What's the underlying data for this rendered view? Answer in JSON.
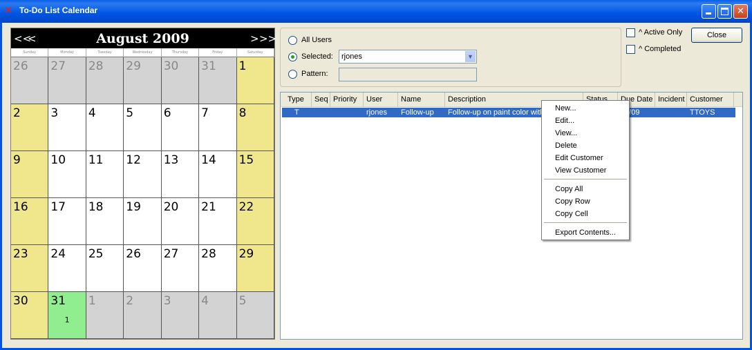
{
  "window": {
    "title": "To-Do List Calendar"
  },
  "calendar": {
    "month_label": "August 2009",
    "nav": {
      "prev_year": "<<",
      "prev_month": "<",
      "next_month": ">",
      "next_year": ">>"
    },
    "days_of_week": [
      "Sunday",
      "Monday",
      "Tuesday",
      "Wednesday",
      "Thursday",
      "Friday",
      "Saturday"
    ],
    "weeks": [
      [
        {
          "d": "26",
          "t": "other"
        },
        {
          "d": "27",
          "t": "other"
        },
        {
          "d": "28",
          "t": "other"
        },
        {
          "d": "29",
          "t": "other"
        },
        {
          "d": "30",
          "t": "other"
        },
        {
          "d": "31",
          "t": "other"
        },
        {
          "d": "1",
          "t": "weekend"
        }
      ],
      [
        {
          "d": "2",
          "t": "weekend"
        },
        {
          "d": "3",
          "t": "day"
        },
        {
          "d": "4",
          "t": "day"
        },
        {
          "d": "5",
          "t": "day"
        },
        {
          "d": "6",
          "t": "day"
        },
        {
          "d": "7",
          "t": "day"
        },
        {
          "d": "8",
          "t": "weekend"
        }
      ],
      [
        {
          "d": "9",
          "t": "weekend"
        },
        {
          "d": "10",
          "t": "day"
        },
        {
          "d": "11",
          "t": "day"
        },
        {
          "d": "12",
          "t": "day"
        },
        {
          "d": "13",
          "t": "day"
        },
        {
          "d": "14",
          "t": "day"
        },
        {
          "d": "15",
          "t": "weekend"
        }
      ],
      [
        {
          "d": "16",
          "t": "weekend"
        },
        {
          "d": "17",
          "t": "day"
        },
        {
          "d": "18",
          "t": "day"
        },
        {
          "d": "19",
          "t": "day"
        },
        {
          "d": "20",
          "t": "day"
        },
        {
          "d": "21",
          "t": "day"
        },
        {
          "d": "22",
          "t": "weekend"
        }
      ],
      [
        {
          "d": "23",
          "t": "weekend"
        },
        {
          "d": "24",
          "t": "day"
        },
        {
          "d": "25",
          "t": "day"
        },
        {
          "d": "26",
          "t": "day"
        },
        {
          "d": "27",
          "t": "day"
        },
        {
          "d": "28",
          "t": "day"
        },
        {
          "d": "29",
          "t": "weekend"
        }
      ],
      [
        {
          "d": "30",
          "t": "weekend"
        },
        {
          "d": "31",
          "t": "today",
          "count": "1"
        },
        {
          "d": "1",
          "t": "other"
        },
        {
          "d": "2",
          "t": "other"
        },
        {
          "d": "3",
          "t": "other"
        },
        {
          "d": "4",
          "t": "other"
        },
        {
          "d": "5",
          "t": "other"
        }
      ]
    ],
    "colors": {
      "weekend": "#f0e68c",
      "today": "#90ee90",
      "other_month": "#d3d3d3"
    }
  },
  "filter": {
    "all_users_label": "All Users",
    "selected_label": "Selected:",
    "selected_value": "rjones",
    "pattern_label": "Pattern:",
    "pattern_value": "",
    "checked_option": "selected"
  },
  "options": {
    "active_only_label": "Active Only",
    "completed_label": "Completed",
    "close_label": "Close"
  },
  "table": {
    "columns": [
      "Type",
      "Seq",
      "Priority",
      "User",
      "Name",
      "Description",
      "Status",
      "Due Date",
      "Incident",
      "Customer"
    ],
    "rows": [
      {
        "type": "T",
        "seq": "",
        "priority": "",
        "user": "rjones",
        "name": "Follow-up",
        "description": "Follow-up on paint color with",
        "status": "",
        "due_date": "31/09",
        "incident": "",
        "customer": "TTOYS"
      }
    ]
  },
  "context_menu": {
    "group1": [
      "New...",
      "Edit...",
      "View...",
      "Delete",
      "Edit Customer",
      "View Customer"
    ],
    "group2": [
      "Copy All",
      "Copy Row",
      "Copy Cell"
    ],
    "group3": [
      "Export Contents..."
    ]
  }
}
